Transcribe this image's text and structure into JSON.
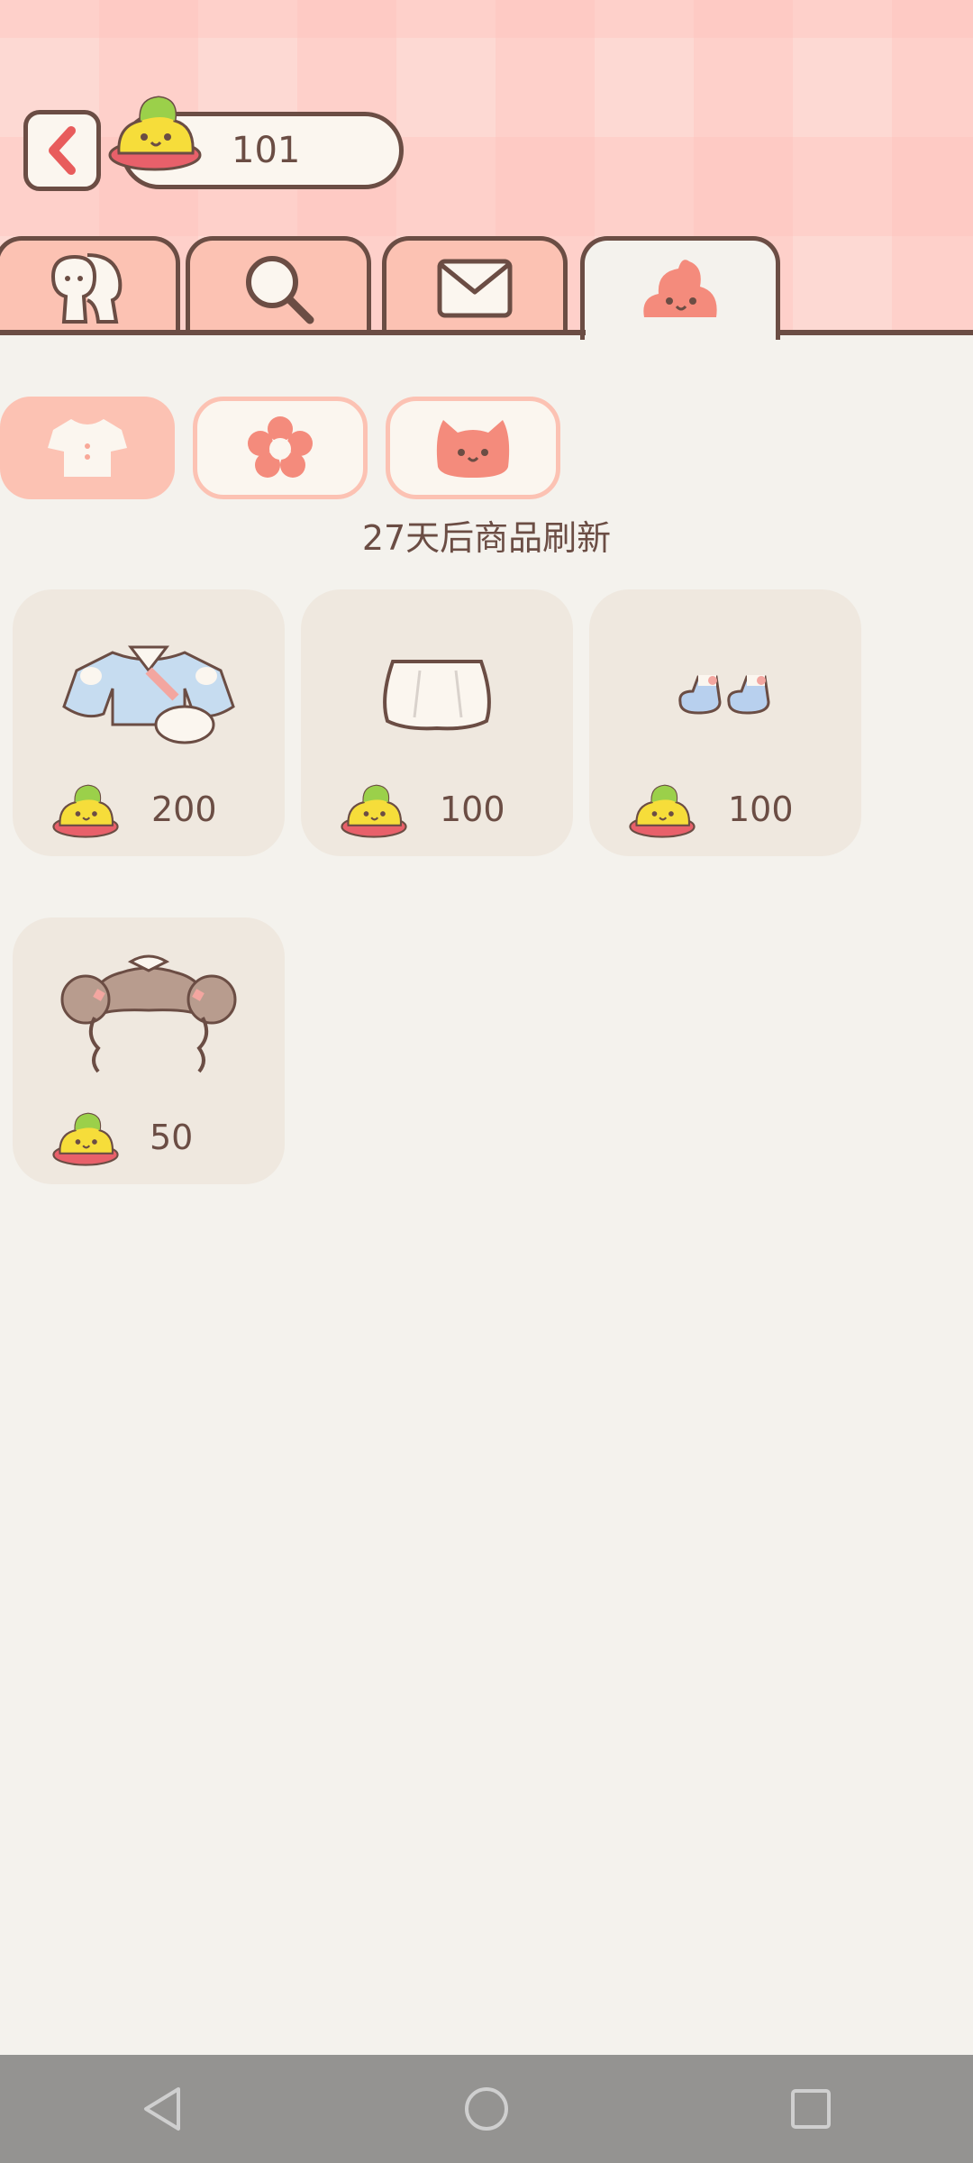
{
  "header": {
    "coin_balance": "101",
    "back_icon": "chevron-left-icon",
    "currency_icon": "poop-coin-icon"
  },
  "tabs": [
    {
      "icon": "friends-icon",
      "active": false
    },
    {
      "icon": "search-icon",
      "active": false
    },
    {
      "icon": "mail-icon",
      "active": false
    },
    {
      "icon": "poop-shop-icon",
      "active": true
    }
  ],
  "categories": [
    {
      "icon": "shirt-icon",
      "selected": true
    },
    {
      "icon": "flower-icon",
      "selected": false
    },
    {
      "icon": "cat-face-icon",
      "selected": false
    }
  ],
  "refresh_text": "27天后商品刷新",
  "items": [
    {
      "name": "outfit",
      "price": "200"
    },
    {
      "name": "skirt",
      "price": "100"
    },
    {
      "name": "shoes",
      "price": "100"
    },
    {
      "name": "hairstyle",
      "price": "50"
    }
  ],
  "navbar": {
    "icons": [
      "back-triangle-icon",
      "home-circle-icon",
      "recents-square-icon"
    ]
  },
  "colors": {
    "accent": "#fcc2b3",
    "outline": "#6b4d44",
    "background": "#f4f2ed",
    "card": "#efe8df"
  }
}
